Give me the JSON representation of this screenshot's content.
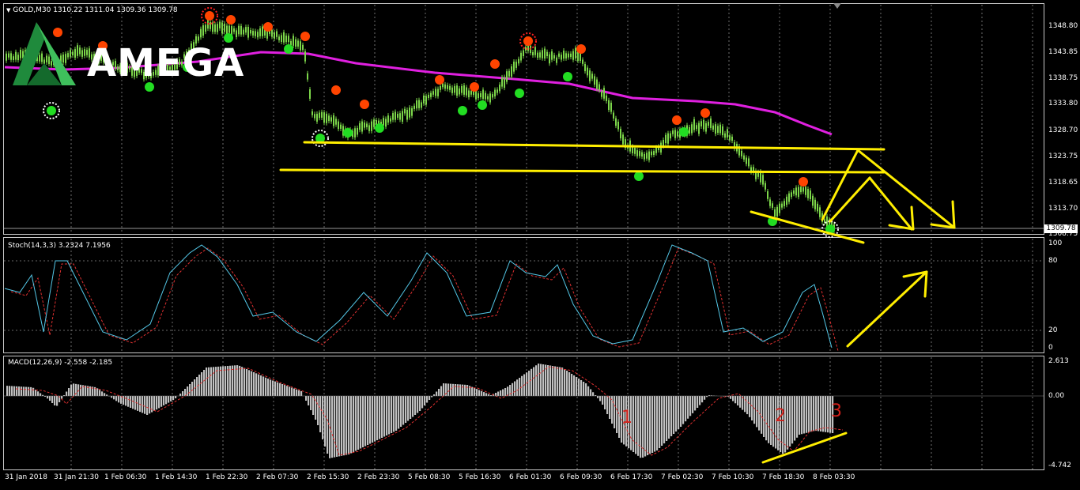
{
  "window": {
    "header": "GOLD,M30  1310.22 1311.04 1309.36 1309.78",
    "menu_arrow": "triangle-down-icon"
  },
  "logo": {
    "text": "AMEGA",
    "mark": "amega-logo-icon",
    "color": "#2e9d4a"
  },
  "price_axis": {
    "labels": [
      "1348.80",
      "1343.85",
      "1338.75",
      "1333.80",
      "1328.70",
      "1323.75",
      "1318.65",
      "1313.70",
      "1308.75"
    ],
    "current_price": "1309.78"
  },
  "stoch": {
    "header": "Stoch(14,3,3) 3.2324 7.1956",
    "levels": [
      "100",
      "80",
      "20",
      "0"
    ],
    "main_color": "#54c8e8",
    "signal_color": "#e03030"
  },
  "macd": {
    "header": "MACD(12,26,9) -2.558 -2.185",
    "levels": [
      "2.613",
      "0.00",
      "-4.742"
    ],
    "histogram_color": "#c0c0c0",
    "signal_color": "#e03030",
    "annotations": [
      "1",
      "2",
      "3"
    ]
  },
  "time_axis": {
    "labels": [
      "31 Jan 2018",
      "31 Jan 21:30",
      "1 Feb 06:30",
      "1 Feb 14:30",
      "1 Feb 22:30",
      "2 Feb 07:30",
      "2 Feb 15:30",
      "2 Feb 23:30",
      "5 Feb 08:30",
      "5 Feb 16:30",
      "6 Feb 01:30",
      "6 Feb 09:30",
      "6 Feb 17:30",
      "7 Feb 02:30",
      "7 Feb 10:30",
      "7 Feb 18:30",
      "8 Feb 03:30"
    ]
  },
  "colors": {
    "candle": "#7cd64a",
    "ma": "#e020e0",
    "trendline": "#ffee00",
    "dot_up": "#22dd22",
    "dot_down": "#ff4400",
    "grid": "#8a8a8a"
  }
}
